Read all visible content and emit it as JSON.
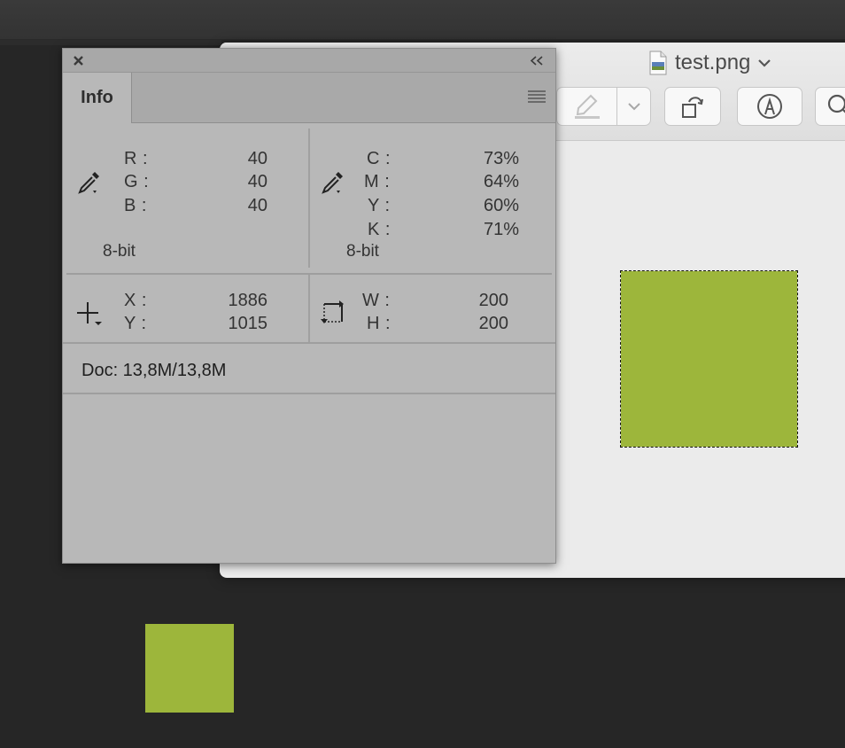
{
  "preview": {
    "file_name": "test.png",
    "icons": {
      "title_dropdown": "chevron-down-icon",
      "markup": "highlighter-icon",
      "markup_menu": "chevron-down-icon",
      "rotate": "rotate-icon",
      "pen": "pen-circle-icon",
      "search": "search-icon"
    },
    "selection_color": "#9db63b"
  },
  "info_panel": {
    "tab_label": "Info",
    "close_icon": "close-icon",
    "collapse_icon": "double-chevron-left-icon",
    "menu_icon": "hamburger-menu-icon",
    "rgb": {
      "labels": [
        "R :",
        "G :",
        "B :"
      ],
      "values": [
        "40",
        "40",
        "40"
      ],
      "bit_depth": "8-bit"
    },
    "cmyk": {
      "labels": [
        "C :",
        "M :",
        "Y :",
        "K :"
      ],
      "values": [
        "73%",
        "64%",
        "60%",
        "71%"
      ],
      "bit_depth": "8-bit"
    },
    "position": {
      "labels": [
        "X :",
        "Y :"
      ],
      "values": [
        "1886",
        "1015"
      ]
    },
    "size": {
      "labels": [
        "W :",
        "H :"
      ],
      "values": [
        "200",
        "200"
      ]
    },
    "doc": "Doc: 13,8M/13,8M"
  },
  "desktop_swatch_color": "#9db63b"
}
